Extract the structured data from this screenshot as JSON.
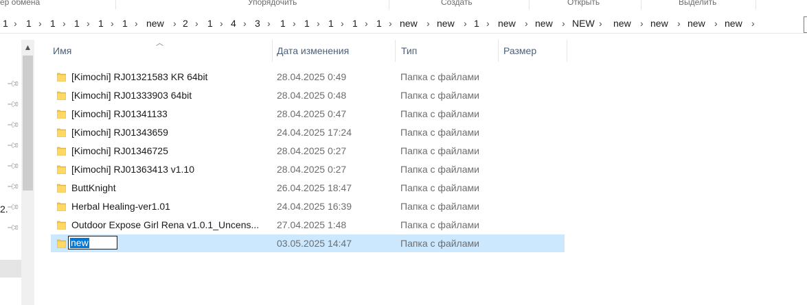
{
  "ribbon": {
    "groups": [
      "ер обмена",
      "Упорядочить",
      "Создать",
      "Открыть",
      "Выделить"
    ]
  },
  "address_bar": {
    "crumbs": [
      "1",
      "1",
      "1",
      "1",
      "1",
      "1",
      "new",
      "2",
      "1",
      "4",
      "3",
      "1",
      "1",
      "1",
      "1",
      "1",
      "new",
      "new",
      "1",
      "new",
      "new",
      "NEW",
      "new",
      "new",
      "new",
      "new"
    ]
  },
  "nav_pane": {
    "cut_text": "2."
  },
  "columns": {
    "name": "Имя",
    "date": "Дата изменения",
    "type": "Тип",
    "size": "Размер"
  },
  "files": [
    {
      "name": "[Kimochi] RJ01321583 KR 64bit",
      "date": "28.04.2025 0:49",
      "type": "Папка с файлами"
    },
    {
      "name": "[Kimochi] RJ01333903 64bit",
      "date": "28.04.2025 0:48",
      "type": "Папка с файлами"
    },
    {
      "name": "[Kimochi] RJ01341133",
      "date": "28.04.2025 0:47",
      "type": "Папка с файлами"
    },
    {
      "name": "[Kimochi] RJ01343659",
      "date": "24.04.2025 17:24",
      "type": "Папка с файлами"
    },
    {
      "name": "[Kimochi] RJ01346725",
      "date": "28.04.2025 0:27",
      "type": "Папка с файлами"
    },
    {
      "name": "[Kimochi] RJ01363413 v1.10",
      "date": "28.04.2025 0:27",
      "type": "Папка с файлами"
    },
    {
      "name": "ButtKnight",
      "date": "26.04.2025 18:47",
      "type": "Папка с файлами"
    },
    {
      "name": "Herbal Healing-ver1.01",
      "date": "24.04.2025 16:39",
      "type": "Папка с файлами"
    },
    {
      "name": "Outdoor Expose Girl Rena v1.0.1_Uncens...",
      "date": "27.04.2025 1:48",
      "type": "Папка с файлами"
    },
    {
      "name": "new",
      "date": "03.05.2025 14:47",
      "type": "Папка с файлами",
      "selected": true,
      "renaming": true
    }
  ],
  "colors": {
    "selection": "#cce8ff",
    "rename_highlight": "#0078d7",
    "folder": "#f3c94b"
  }
}
